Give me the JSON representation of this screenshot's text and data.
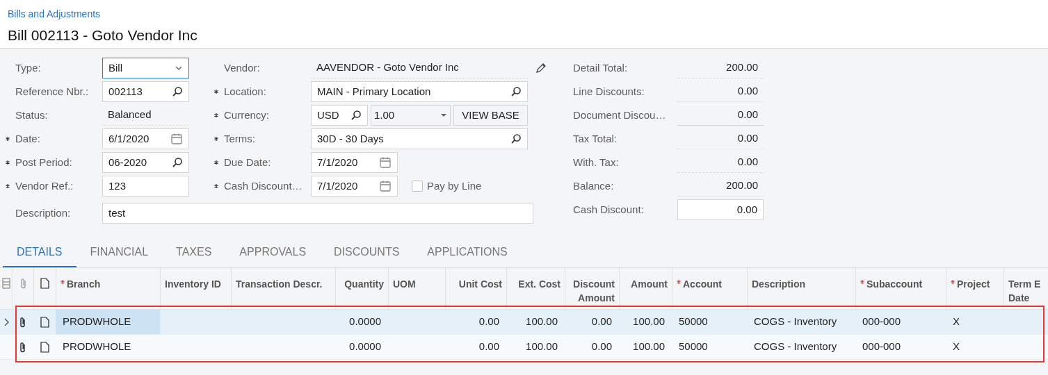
{
  "breadcrumb": "Bills and Adjustments",
  "title": "Bill 002113 - Goto Vendor Inc",
  "left_fields": [
    {
      "label": "Type:",
      "required": false,
      "kind": "dropdown",
      "value": "Bill"
    },
    {
      "label": "Reference Nbr.:",
      "required": false,
      "kind": "lookup",
      "value": "002113"
    },
    {
      "label": "Status:",
      "required": false,
      "kind": "plain",
      "value": "Balanced"
    },
    {
      "label": "Date:",
      "required": true,
      "kind": "date",
      "value": "6/1/2020"
    },
    {
      "label": "Post Period:",
      "required": true,
      "kind": "lookup",
      "value": "06-2020"
    },
    {
      "label": "Vendor Ref.:",
      "required": true,
      "kind": "text",
      "value": "123"
    }
  ],
  "description": {
    "label": "Description:",
    "value": "test"
  },
  "middle_fields": [
    {
      "label": "Vendor:",
      "required": false,
      "kind": "plain",
      "value": "AAVENDOR - Goto Vendor Inc"
    },
    {
      "label": "Location:",
      "required": true,
      "kind": "lookup",
      "value": "MAIN - Primary Location"
    },
    {
      "label": "Currency:",
      "required": true,
      "kind": "currency",
      "value": "USD",
      "rate": "1.00",
      "button": "VIEW BASE"
    },
    {
      "label": "Terms:",
      "required": true,
      "kind": "lookup",
      "value": "30D - 30 Days"
    },
    {
      "label": "Due Date:",
      "required": true,
      "kind": "date",
      "value": "7/1/2020"
    },
    {
      "label": "Cash Discount…",
      "required": true,
      "kind": "date",
      "value": "7/1/2020",
      "checkbox": {
        "label": "Pay by Line",
        "checked": false
      }
    }
  ],
  "totals": [
    {
      "label": "Detail Total:",
      "kind": "plain",
      "value": "200.00"
    },
    {
      "label": "Line Discounts:",
      "kind": "plain",
      "value": "0.00"
    },
    {
      "label": "Document Discou…",
      "kind": "plain",
      "value": "0.00"
    },
    {
      "label": "Tax Total:",
      "kind": "plain",
      "value": "0.00"
    },
    {
      "label": "With. Tax:",
      "kind": "plain",
      "value": "0.00"
    },
    {
      "label": "Balance:",
      "kind": "plain",
      "value": "200.00"
    },
    {
      "label": "Cash Discount:",
      "kind": "field",
      "value": "0.00"
    }
  ],
  "tabs": [
    {
      "label": "DETAILS",
      "selected": true
    },
    {
      "label": "FINANCIAL",
      "selected": false
    },
    {
      "label": "TAXES",
      "selected": false
    },
    {
      "label": "APPROVALS",
      "selected": false
    },
    {
      "label": "DISCOUNTS",
      "selected": false
    },
    {
      "label": "APPLICATIONS",
      "selected": false
    }
  ],
  "table": {
    "columns": [
      {
        "label": "Branch",
        "required": true
      },
      {
        "label": "Inventory ID",
        "required": false
      },
      {
        "label": "Transaction Descr.",
        "required": false
      },
      {
        "label": "Quantity",
        "required": false
      },
      {
        "label": "UOM",
        "required": false
      },
      {
        "label": "Unit Cost",
        "required": false
      },
      {
        "label": "Ext. Cost",
        "required": false
      },
      {
        "label": "Discount Amount",
        "required": false
      },
      {
        "label": "Amount",
        "required": false
      },
      {
        "label": "Account",
        "required": true
      },
      {
        "label": "Description",
        "required": false
      },
      {
        "label": "Subaccount",
        "required": true
      },
      {
        "label": "Project",
        "required": true
      },
      {
        "label": "Term E Date",
        "required": false
      }
    ],
    "rows": [
      {
        "selected": true,
        "cells": [
          "PRODWHOLE",
          "",
          "",
          "0.0000",
          "",
          "0.00",
          "100.00",
          "0.00",
          "100.00",
          "50000",
          "COGS - Inventory",
          "000-000",
          "X",
          ""
        ]
      },
      {
        "selected": false,
        "cells": [
          "PRODWHOLE",
          "",
          "",
          "0.0000",
          "",
          "0.00",
          "100.00",
          "0.00",
          "100.00",
          "50000",
          "COGS - Inventory",
          "000-000",
          "X",
          ""
        ]
      }
    ]
  }
}
